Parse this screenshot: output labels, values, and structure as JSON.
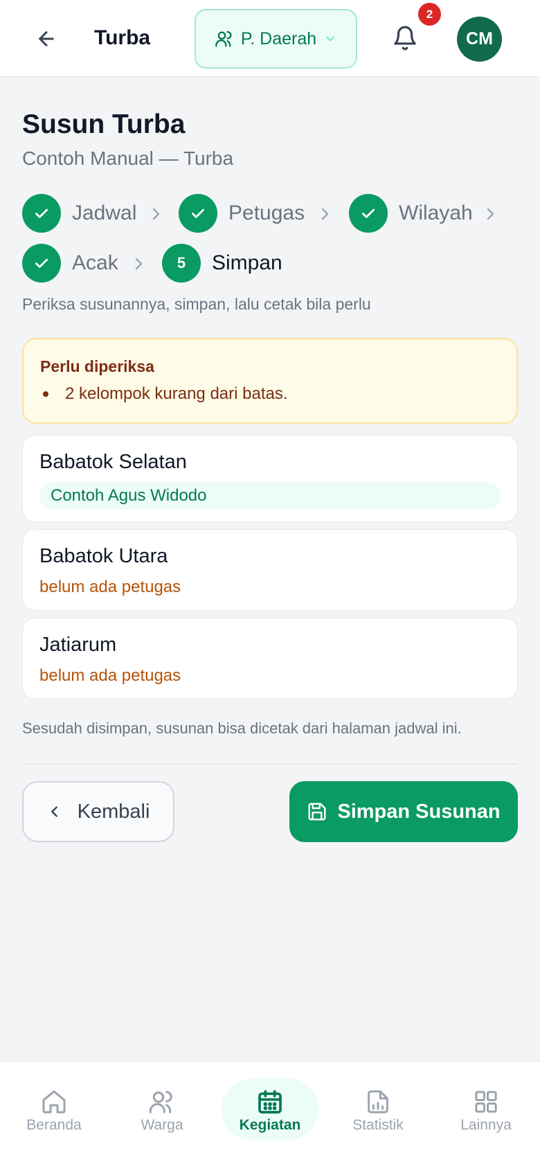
{
  "header": {
    "title": "Turba",
    "role_label": "P. Daerah",
    "notification_count": "2",
    "avatar_initials": "CM"
  },
  "page": {
    "title": "Susun Turba",
    "subtitle": "Contoh Manual — Turba",
    "hint": "Periksa susunannya, simpan, lalu cetak bila perlu"
  },
  "stepper": {
    "steps": [
      {
        "label": "Jadwal",
        "status": "done"
      },
      {
        "label": "Petugas",
        "status": "done"
      },
      {
        "label": "Wilayah",
        "status": "done"
      },
      {
        "label": "Acak",
        "status": "done"
      },
      {
        "label": "Simpan",
        "status": "current",
        "number": "5"
      }
    ]
  },
  "alert": {
    "title": "Perlu diperiksa",
    "items": [
      "2 kelompok kurang dari batas."
    ]
  },
  "groups": [
    {
      "name": "Babatok Selatan",
      "assignee": "Contoh Agus Widodo",
      "unassigned_text": ""
    },
    {
      "name": "Babatok Utara",
      "assignee": "",
      "unassigned_text": "belum ada petugas"
    },
    {
      "name": "Jatiarum",
      "assignee": "",
      "unassigned_text": "belum ada petugas"
    }
  ],
  "footer_note": "Sesudah disimpan, susunan bisa dicetak dari halaman jadwal ini.",
  "actions": {
    "back_label": "Kembali",
    "save_label": "Simpan Susunan"
  },
  "bottom_nav": {
    "items": [
      {
        "label": "Beranda",
        "icon": "home-icon"
      },
      {
        "label": "Warga",
        "icon": "users-icon"
      },
      {
        "label": "Kegiatan",
        "icon": "calendar-icon",
        "active": true
      },
      {
        "label": "Statistik",
        "icon": "chart-file-icon"
      },
      {
        "label": "Lainnya",
        "icon": "grid-icon"
      }
    ]
  },
  "colors": {
    "primary": "#0a9a63",
    "primary_dark": "#0f6b4b",
    "warning_bg": "#fefbe8",
    "warning_border": "#fbe29a",
    "warning_text": "#7c2d12",
    "unassigned_text": "#b45309",
    "badge": "#dc2626"
  }
}
